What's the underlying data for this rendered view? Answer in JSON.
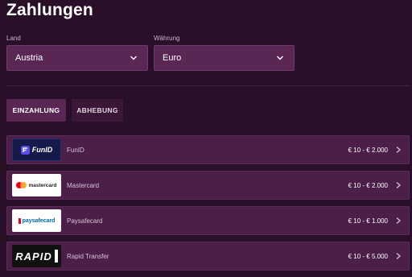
{
  "page": {
    "title": "Zahlungen"
  },
  "filters": {
    "country": {
      "label": "Land",
      "value": "Austria"
    },
    "currency": {
      "label": "Währung",
      "value": "Euro"
    }
  },
  "tabs": [
    {
      "label": "EINZAHLUNG",
      "active": true
    },
    {
      "label": "ABHEBUNG",
      "active": false
    }
  ],
  "methods": [
    {
      "name": "FunID",
      "range": "€ 10 - € 2.000",
      "logo_text": "FunID",
      "icon": "funid-logo"
    },
    {
      "name": "Mastercard",
      "range": "€ 10 - € 2.000",
      "logo_text": "mastercard",
      "icon": "mastercard-logo"
    },
    {
      "name": "Paysafecard",
      "range": "€ 10 - € 1.000",
      "logo_text": "paysafecard",
      "icon": "paysafecard-logo"
    },
    {
      "name": "Rapid Transfer",
      "range": "€ 10 - € 5.000",
      "logo_text": "RAPID",
      "icon": "rapid-transfer-logo"
    }
  ],
  "colors": {
    "background": "#2a0f29",
    "accent": "#5a2755",
    "row": "#4b1f47"
  }
}
